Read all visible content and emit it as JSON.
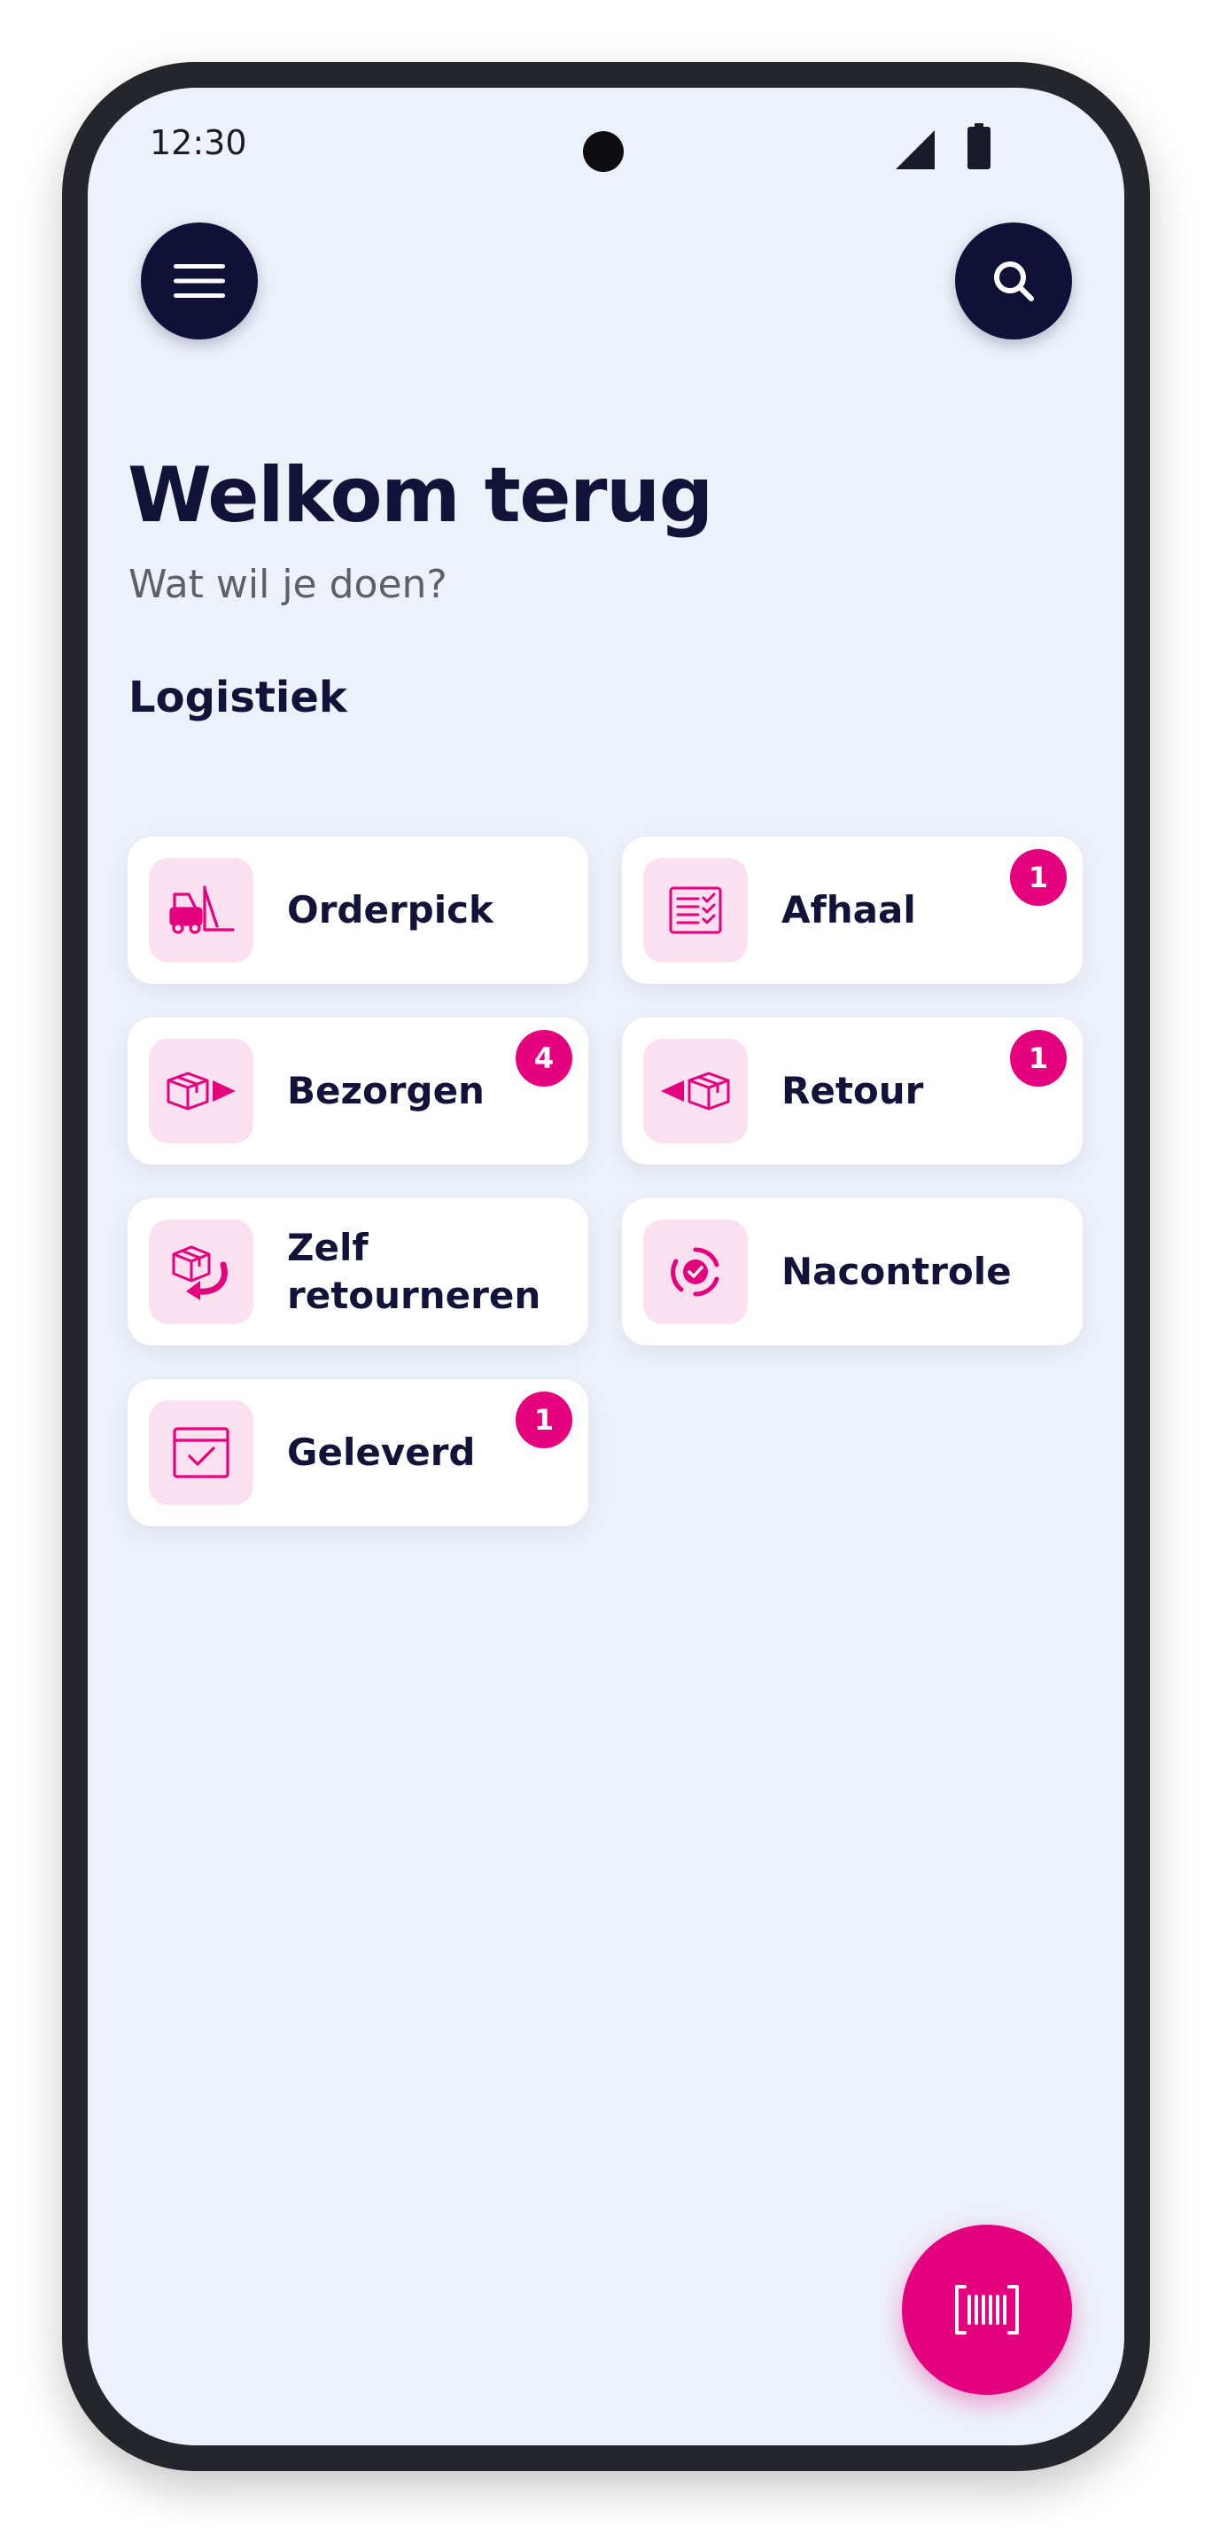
{
  "status_bar": {
    "time": "12:30",
    "icons": [
      "camera-cutout",
      "cellular-signal-icon",
      "battery-icon"
    ]
  },
  "header": {
    "menu_icon": "hamburger-menu-icon",
    "search_icon": "search-icon"
  },
  "main": {
    "title": "Welkom terug",
    "subtitle": "Wat wil je doen?",
    "section_title": "Logistiek",
    "tiles": [
      {
        "label": "Orderpick",
        "icon": "forklift-icon",
        "badge": ""
      },
      {
        "label": "Afhaal",
        "icon": "checklist-icon",
        "badge": "1"
      },
      {
        "label": "Bezorgen",
        "icon": "box-arrow-right-icon",
        "badge": "4"
      },
      {
        "label": "Retour",
        "icon": "box-arrow-left-icon",
        "badge": "1"
      },
      {
        "label": "Zelf retourneren",
        "icon": "box-return-arrow-icon",
        "badge": ""
      },
      {
        "label": "Nacontrole",
        "icon": "check-circle-icon",
        "badge": ""
      },
      {
        "label": "Geleverd",
        "icon": "calendar-check-icon",
        "badge": "1"
      }
    ]
  },
  "fab": {
    "icon": "barcode-scan-icon"
  },
  "colors": {
    "accent": "#e5007d",
    "navy": "#0f1136",
    "background": "#edf1fa",
    "icon_tile": "#fbe1ef"
  }
}
